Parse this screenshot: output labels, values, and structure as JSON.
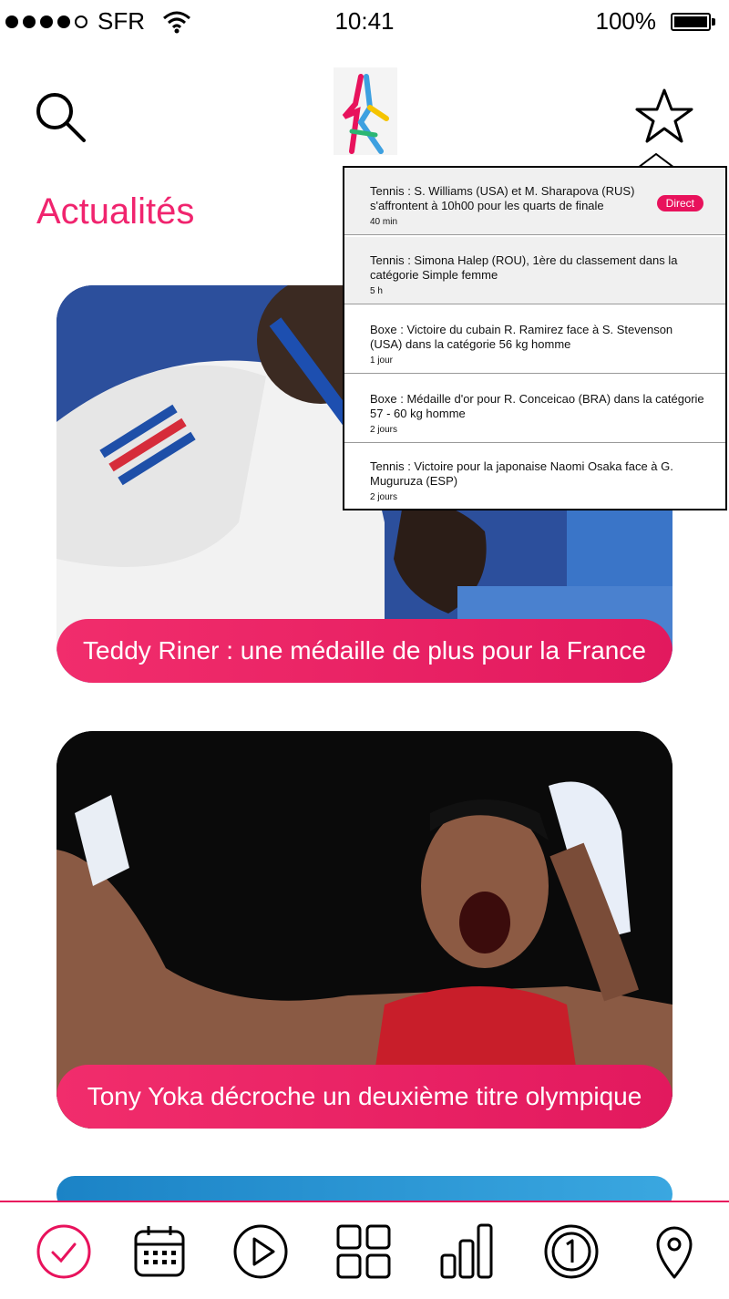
{
  "status_bar": {
    "carrier": "SFR",
    "time": "10:41",
    "battery": "100%"
  },
  "section_title": "Actualités",
  "cards": [
    {
      "caption": "Teddy Riner : une médaille de plus pour la France"
    },
    {
      "caption": "Tony Yoka décroche un deuxième titre olympique"
    }
  ],
  "notifications": [
    {
      "text": "Tennis : S. Williams (USA) et M. Sharapova (RUS) s'affrontent à 10h00 pour les quarts de finale",
      "time": "40 min",
      "badge": "Direct"
    },
    {
      "text": "Tennis : Simona Halep (ROU), 1ère du classement dans la catégorie Simple femme",
      "time": "5 h"
    },
    {
      "text": "Boxe : Victoire du cubain R. Ramirez face à S. Stevenson (USA) dans la catégorie 56 kg homme",
      "time": "1 jour"
    },
    {
      "text": "Boxe : Médaille d'or pour R. Conceicao (BRA) dans la catégorie 57 - 60 kg homme",
      "time": "2 jours"
    },
    {
      "text": "Tennis : Victoire pour la japonaise Naomi Osaka face à G. Muguruza (ESP)",
      "time": "2 jours"
    }
  ],
  "icons": {
    "header": [
      "search-icon",
      "paris-logo",
      "star-icon"
    ],
    "tabs": [
      "check-icon",
      "calendar-icon",
      "play-icon",
      "grid-icon",
      "bar-chart-icon",
      "number-one-icon",
      "location-pin-icon"
    ]
  },
  "colors": {
    "accent": "#f0246e",
    "badge": "#e8125c",
    "caption_bg": "#f12d6c"
  }
}
